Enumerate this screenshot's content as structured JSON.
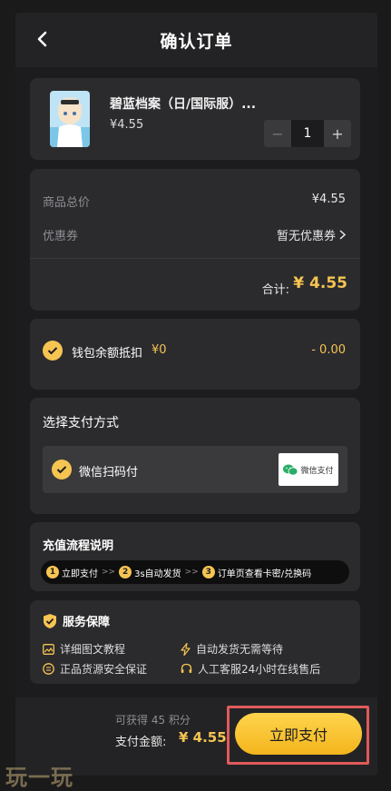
{
  "header": {
    "title": "确认订单",
    "back_icon": "chevron-left-icon"
  },
  "product": {
    "name": "碧蓝档案（日/国际服）...",
    "price": "¥4.55",
    "quantity": "1",
    "minus": "−",
    "plus": "+"
  },
  "price_summary": {
    "subtotal_label": "商品总价",
    "subtotal_value": "¥4.55",
    "coupon_label": "优惠券",
    "coupon_value": "暂无优惠券",
    "total_label": "合计:",
    "total_value": "¥ 4.55"
  },
  "wallet": {
    "label": "钱包余额抵扣",
    "balance": "¥0",
    "deduction": "- 0.00"
  },
  "payment": {
    "title": "选择支付方式",
    "option_label": "微信扫码付",
    "logo_text": "微信支付"
  },
  "flow": {
    "title": "充值流程说明",
    "steps": [
      {
        "num": "1",
        "label": "立即支付"
      },
      {
        "num": "2",
        "label": "3s自动发货"
      },
      {
        "num": "3",
        "label": "订单页查看卡密/兑换码"
      }
    ],
    "separator": ">>"
  },
  "service": {
    "title": "服务保障",
    "items": [
      "详细图文教程",
      "自动发货无需等待",
      "正品货源安全保证",
      "人工客服24小时在线售后"
    ]
  },
  "bottom": {
    "points": "可获得 45 积分",
    "pay_amount_label": "支付金额:",
    "pay_amount": "¥ 4.55",
    "pay_button": "立即支付"
  },
  "watermark": "玩一玩",
  "colors": {
    "accent": "#f5c451",
    "background": "#1c1c1e",
    "card": "#2b2b2e",
    "highlight": "#e05a5a"
  }
}
